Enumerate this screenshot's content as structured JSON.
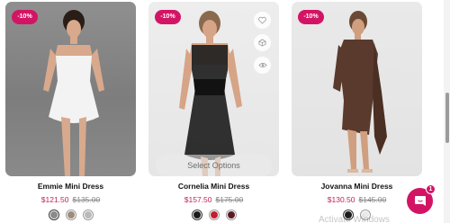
{
  "products": [
    {
      "name": "Emmie Mini Dress",
      "badge": "-10%",
      "sale_price": "$121.50",
      "compare_price": "$135.00",
      "swatches": [
        "#8a8a8a",
        "#a08a78",
        "#b9b9b9"
      ],
      "selected_swatch": 0,
      "dress_color": "#f1f1f1"
    },
    {
      "name": "Cornelia Mini Dress",
      "badge": "-10%",
      "sale_price": "$157.50",
      "compare_price": "$175.00",
      "swatches": [
        "#1a1a1a",
        "#c21f2e",
        "#5a1a22"
      ],
      "selected_swatch": 0,
      "dress_color": "#1c1c1c",
      "select_options_label": "Select Options",
      "side_icons": [
        "heart-icon",
        "compare-icon",
        "eye-icon"
      ]
    },
    {
      "name": "Jovanna Mini Dress",
      "badge": "-10%",
      "sale_price": "$130.50",
      "compare_price": "$145.00",
      "swatches": [
        "#1c1c1c",
        "#e9e9e9"
      ],
      "selected_swatch": 0,
      "dress_color": "#5a3a2c"
    }
  ],
  "chat": {
    "count": "1",
    "icon": "chat-bubble-icon"
  },
  "watermark": "Activate Windows",
  "colors": {
    "accent": "#d31464",
    "sale": "#c41f5e"
  }
}
